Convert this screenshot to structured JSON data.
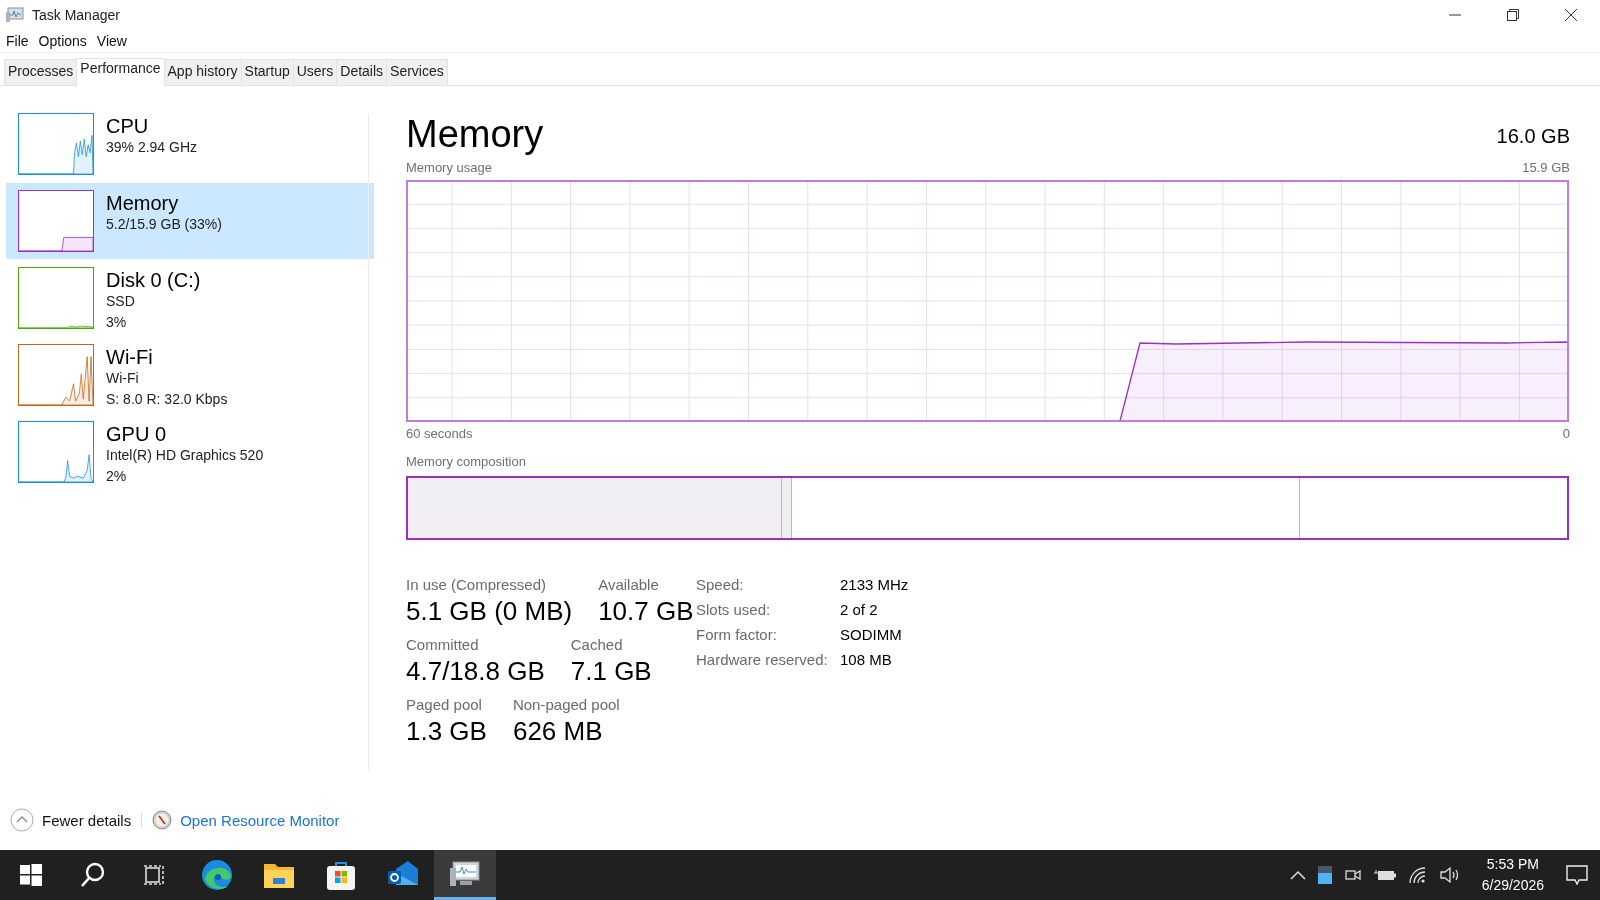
{
  "window": {
    "title": "Task Manager"
  },
  "menu": [
    "File",
    "Options",
    "View"
  ],
  "tabs": [
    {
      "label": "Processes",
      "selected": false
    },
    {
      "label": "Performance",
      "selected": true
    },
    {
      "label": "App history",
      "selected": false
    },
    {
      "label": "Startup",
      "selected": false
    },
    {
      "label": "Users",
      "selected": false
    },
    {
      "label": "Details",
      "selected": false
    },
    {
      "label": "Services",
      "selected": false
    }
  ],
  "sidebar": {
    "items": [
      {
        "kind": "cpu",
        "name": "CPU",
        "lines": [
          "39%  2.94 GHz"
        ],
        "color": "#1c8fd8",
        "selected": false
      },
      {
        "kind": "memory",
        "name": "Memory",
        "lines": [
          "5.2/15.9 GB (33%)"
        ],
        "color": "#9a2fc9",
        "selected": true
      },
      {
        "kind": "disk",
        "name": "Disk 0 (C:)",
        "lines": [
          "SSD",
          "3%"
        ],
        "color": "#4ca90c",
        "selected": false
      },
      {
        "kind": "wifi",
        "name": "Wi-Fi",
        "lines": [
          "Wi-Fi",
          "S: 8.0  R: 32.0 Kbps"
        ],
        "color": "#c4661a",
        "selected": false
      },
      {
        "kind": "gpu",
        "name": "GPU 0",
        "lines": [
          "Intel(R) HD Graphics 520",
          "2%"
        ],
        "color": "#1c8fd8",
        "selected": false
      }
    ]
  },
  "detail": {
    "title": "Memory",
    "total": "16.0 GB",
    "usage": {
      "label": "Memory usage",
      "max": "15.9 GB",
      "time_start": "60 seconds",
      "time_end": "0"
    },
    "composition": {
      "label": "Memory composition"
    },
    "stats": [
      [
        {
          "label": "In use (Compressed)",
          "value": "5.1 GB (0 MB)"
        },
        {
          "label": "Available",
          "value": "10.7 GB"
        }
      ],
      [
        {
          "label": "Committed",
          "value": "4.7/18.8 GB"
        },
        {
          "label": "Cached",
          "value": "7.1 GB"
        }
      ],
      [
        {
          "label": "Paged pool",
          "value": "1.3 GB"
        },
        {
          "label": "Non-paged pool",
          "value": "626 MB"
        }
      ]
    ],
    "properties": [
      {
        "label": "Speed:",
        "value": "2133 MHz"
      },
      {
        "label": "Slots used:",
        "value": "2 of 2"
      },
      {
        "label": "Form factor:",
        "value": "SODIMM"
      },
      {
        "label": "Hardware reserved:",
        "value": "108 MB"
      }
    ]
  },
  "footer": {
    "fewer_details": "Fewer details",
    "link": "Open Resource Monitor"
  },
  "taskbar": {
    "apps": [
      {
        "kind": "start",
        "selected": false
      },
      {
        "kind": "search",
        "selected": false
      },
      {
        "kind": "task-view",
        "selected": false
      },
      {
        "kind": "edge",
        "selected": false
      },
      {
        "kind": "explorer",
        "selected": false
      },
      {
        "kind": "store",
        "selected": false
      },
      {
        "kind": "outlook",
        "selected": false
      },
      {
        "kind": "task-manager",
        "selected": true
      }
    ],
    "time": "5:53 PM",
    "date": "6/29/2026"
  }
}
